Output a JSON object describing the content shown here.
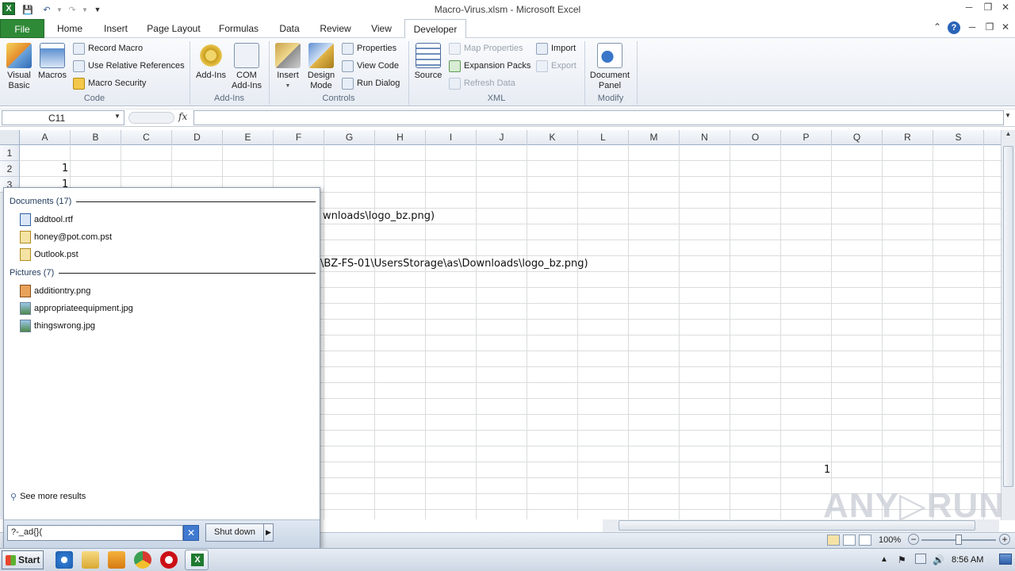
{
  "window": {
    "title": "Macro-Virus.xlsm  -  Microsoft Excel"
  },
  "ribbon": {
    "tabs": [
      "File",
      "Home",
      "Insert",
      "Page Layout",
      "Formulas",
      "Data",
      "Review",
      "View",
      "Developer"
    ],
    "active_tab": "Developer",
    "code": {
      "label": "Code",
      "visual_basic": "Visual\nBasic",
      "macros": "Macros",
      "record_macro": "Record Macro",
      "relative_refs": "Use Relative References",
      "macro_security": "Macro Security"
    },
    "addins": {
      "label": "Add-Ins",
      "addins": "Add-Ins",
      "com_addins": "COM\nAdd-Ins"
    },
    "controls": {
      "label": "Controls",
      "insert": "Insert",
      "design_mode": "Design\nMode",
      "properties": "Properties",
      "view_code": "View Code",
      "run_dialog": "Run Dialog"
    },
    "xml": {
      "label": "XML",
      "source": "Source",
      "map_properties": "Map Properties",
      "expansion_packs": "Expansion Packs",
      "refresh_data": "Refresh Data",
      "import": "Import",
      "export": "Export"
    },
    "modify": {
      "label": "Modify",
      "document_panel": "Document\nPanel"
    }
  },
  "formula_bar": {
    "name_box": "C11",
    "fx": "fx",
    "formula": ""
  },
  "sheet": {
    "columns": [
      "A",
      "B",
      "C",
      "D",
      "E",
      "F",
      "G",
      "H",
      "I",
      "J",
      "K",
      "L",
      "M",
      "N",
      "O",
      "P",
      "Q",
      "R",
      "S"
    ],
    "rows": [
      "1",
      "2",
      "3"
    ],
    "cells": {
      "A2": "1",
      "A3": "1",
      "G5": "wnloads\\logo_bz.png)",
      "G8": "\\BZ-FS-01\\UsersStorage\\as\\Downloads\\logo_bz.png)",
      "P21": "1"
    }
  },
  "status": {
    "zoom": "100%"
  },
  "start_menu": {
    "documents_header": "Documents (17)",
    "documents": [
      "addtool.rtf",
      "honey@pot.com.pst",
      "Outlook.pst"
    ],
    "pictures_header": "Pictures (7)",
    "pictures": [
      "additiontry.png",
      "appropriateequipment.jpg",
      "thingswrong.jpg"
    ],
    "see_more": "See more results",
    "search_value": "?-_ad{}(",
    "shutdown": "Shut down"
  },
  "taskbar": {
    "start": "Start",
    "clock": "8:56 AM"
  },
  "watermark": "ANY RUN"
}
